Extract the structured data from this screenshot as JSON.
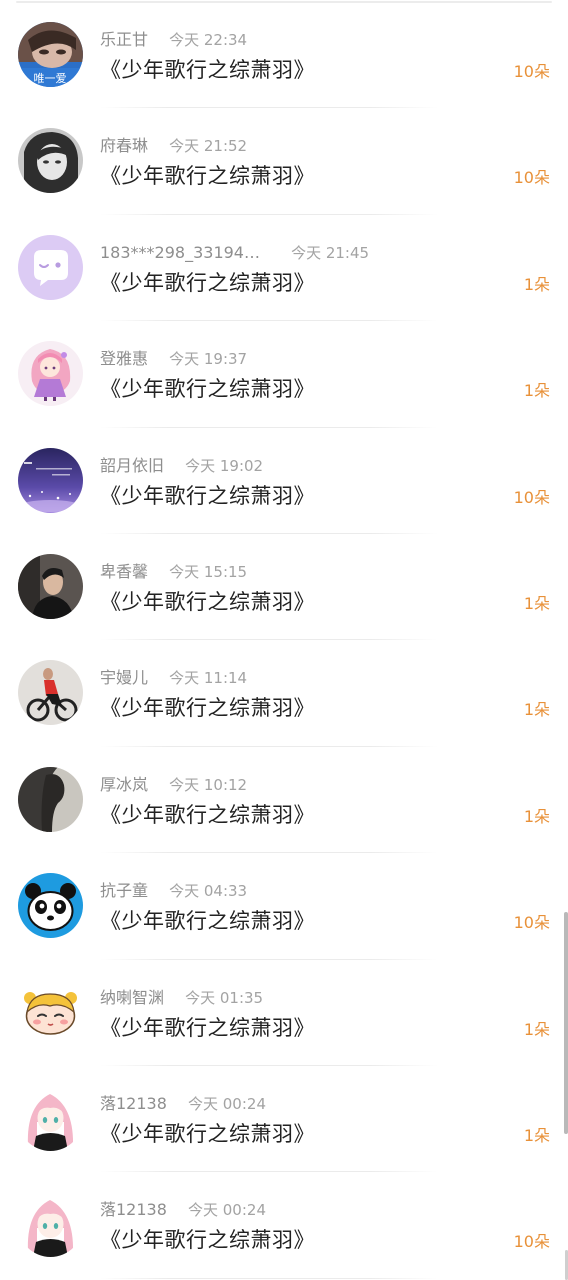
{
  "list": {
    "items": [
      {
        "name": "乐正甘",
        "time": "今天 22:34",
        "title": "《少年歌行之综萧羽》",
        "count": "10朵",
        "avatar": "girl-photo-avatar",
        "avatar_bg": "#2b6fc7",
        "avatar_caption": "唯一爱"
      },
      {
        "name": "府春琳",
        "time": "今天 21:52",
        "title": "《少年歌行之综萧羽》",
        "count": "10朵",
        "avatar": "girl-bw-photo-avatar",
        "avatar_bg": "#8a8a8a"
      },
      {
        "name": "183***298_33194…",
        "time": "今天 21:45",
        "title": "《少年歌行之综萧羽》",
        "count": "1朵",
        "avatar": "chat-bubble-default-avatar",
        "avatar_bg": "#d9c8f2"
      },
      {
        "name": "登雅惠",
        "time": "今天 19:37",
        "title": "《少年歌行之综萧羽》",
        "count": "1朵",
        "avatar": "anime-princess-avatar",
        "avatar_bg": "#f7eef4"
      },
      {
        "name": "韶月依旧",
        "time": "今天 19:02",
        "title": "《少年歌行之综萧羽》",
        "count": "10朵",
        "avatar": "purple-night-avatar",
        "avatar_bg": "#3a2f7a"
      },
      {
        "name": "卑香馨",
        "time": "今天 15:15",
        "title": "《少年歌行之综萧羽》",
        "count": "1朵",
        "avatar": "man-photo-avatar",
        "avatar_bg": "#3d3a38"
      },
      {
        "name": "宇嫚儿",
        "time": "今天 11:14",
        "title": "《少年歌行之综萧羽》",
        "count": "1朵",
        "avatar": "cyclist-photo-avatar",
        "avatar_bg": "#d9d6d2"
      },
      {
        "name": "厚冰岚",
        "time": "今天 10:12",
        "title": "《少年歌行之综萧羽》",
        "count": "1朵",
        "avatar": "silhouette-avatar",
        "avatar_bg": "#4a4a48"
      },
      {
        "name": "抗子童",
        "time": "今天 04:33",
        "title": "《少年歌行之综萧羽》",
        "count": "10朵",
        "avatar": "panda-avatar",
        "avatar_bg": "#1e9be0"
      },
      {
        "name": "纳喇智渊",
        "time": "今天 01:35",
        "title": "《少年歌行之综萧羽》",
        "count": "1朵",
        "avatar": "cartoon-girl-avatar",
        "avatar_bg": "#ffffff"
      },
      {
        "name": "落12138",
        "time": "今天 00:24",
        "title": "《少年歌行之综萧羽》",
        "count": "1朵",
        "avatar": "pink-hair-anime-avatar",
        "avatar_bg": "#ffffff"
      },
      {
        "name": "落12138",
        "time": "今天 00:24",
        "title": "《少年歌行之综萧羽》",
        "count": "10朵",
        "avatar": "pink-hair-anime-avatar",
        "avatar_bg": "#ffffff"
      }
    ]
  },
  "colors": {
    "count": "#e89139",
    "meta": "#8e8e8e",
    "title": "#222222"
  }
}
